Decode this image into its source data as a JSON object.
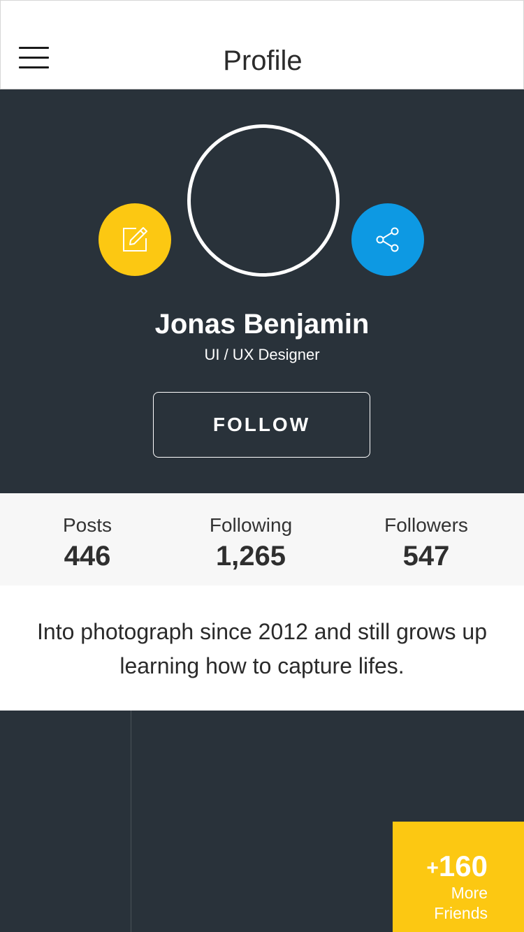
{
  "header": {
    "title": "Profile"
  },
  "profile": {
    "name": "Jonas Benjamin",
    "role": "UI / UX Designer",
    "follow_label": "FOLLOW",
    "bio": "Into photograph since 2012 and still grows up learning how to capture lifes."
  },
  "stats": {
    "posts": {
      "label": "Posts",
      "value": "446"
    },
    "following": {
      "label": "Following",
      "value": "1,265"
    },
    "followers": {
      "label": "Followers",
      "value": "547"
    }
  },
  "friends": {
    "count": "160",
    "plus": "+",
    "label_line1": "More",
    "label_line2": "Friends"
  },
  "icons": {
    "menu": "hamburger-icon",
    "edit": "edit-icon",
    "share": "share-icon"
  },
  "colors": {
    "dark": "#29323a",
    "accent_yellow": "#fcc812",
    "accent_blue": "#0d99e3"
  }
}
